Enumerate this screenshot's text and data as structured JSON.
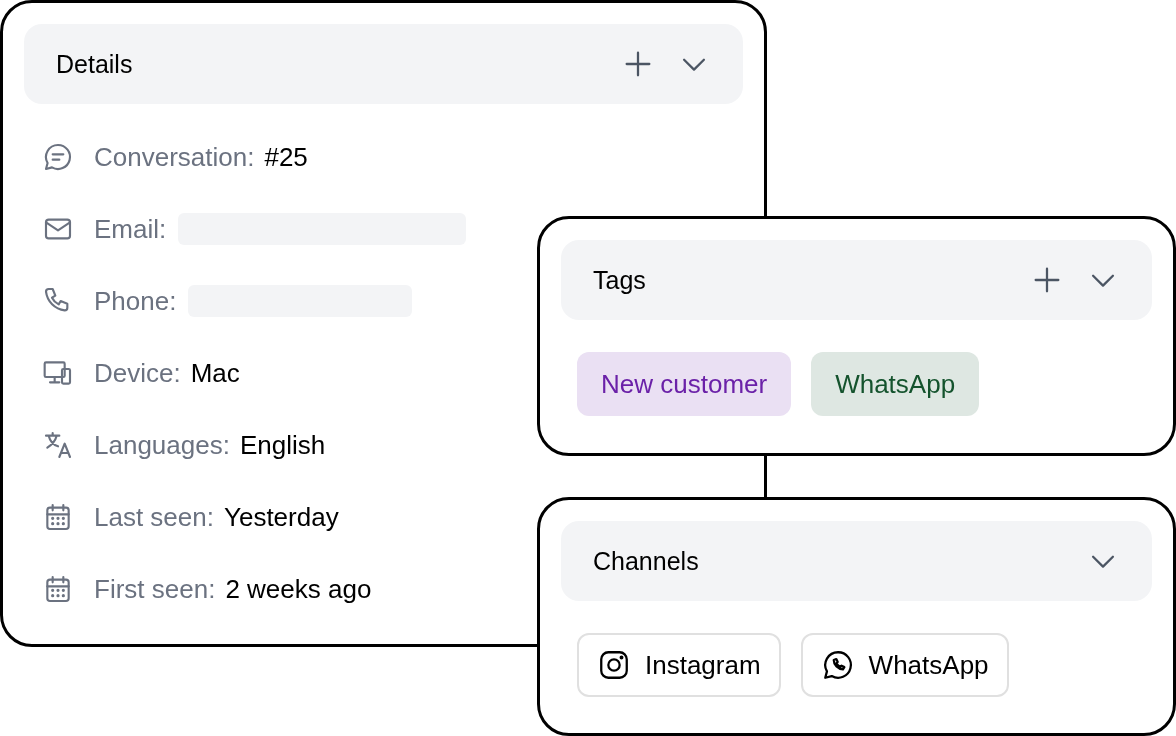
{
  "details": {
    "title": "Details",
    "has_add": true,
    "expanded": true,
    "rows": [
      {
        "kind": "conversation",
        "label": "Conversation:",
        "value": "#25",
        "redacted": false
      },
      {
        "kind": "email",
        "label": "Email:",
        "redacted": true
      },
      {
        "kind": "phone",
        "label": "Phone:",
        "redacted": true
      },
      {
        "kind": "device",
        "label": "Device:",
        "value": "Mac",
        "redacted": false
      },
      {
        "kind": "languages",
        "label": "Languages:",
        "value": "English",
        "redacted": false
      },
      {
        "kind": "calendar",
        "label": "Last seen:",
        "value": "Yesterday",
        "redacted": false
      },
      {
        "kind": "calendar",
        "label": "First seen:",
        "value": "2 weeks ago",
        "redacted": false
      }
    ]
  },
  "tags": {
    "title": "Tags",
    "has_add": true,
    "expanded": true,
    "items": [
      {
        "label": "New customer",
        "color": "#6b21a8"
      },
      {
        "label": "WhatsApp",
        "color": "#14532d"
      }
    ]
  },
  "channels": {
    "title": "Channels",
    "has_add": false,
    "expanded": true,
    "items": [
      {
        "kind": "instagram",
        "label": "Instagram"
      },
      {
        "kind": "whatsapp",
        "label": "WhatsApp"
      }
    ]
  }
}
